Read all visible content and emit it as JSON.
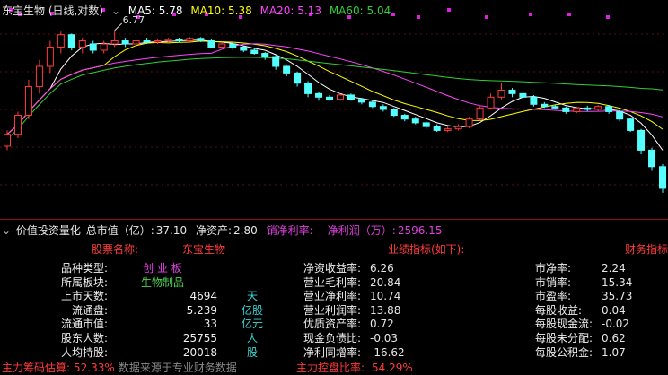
{
  "chart_header": {
    "title": "东宝生物 (日线,对数)",
    "ma": [
      {
        "label": "MA5: 5.78",
        "color": "#ffffff"
      },
      {
        "label": "MA10: 5.38",
        "color": "#ffff00"
      },
      {
        "label": "MA20: 5.13",
        "color": "#ff44ff"
      },
      {
        "label": "MA60: 5.04",
        "color": "#33cc33"
      }
    ],
    "high_marker": "6.77"
  },
  "panel": {
    "title": "价值投资量化",
    "mkt_cap_label": "总市值（亿）:",
    "mkt_cap_value": "37.10",
    "net_asset_label": "净资产:",
    "net_asset_value": "2.80",
    "net_margin_label": "销净利率:",
    "net_margin_value": "-",
    "net_profit_label": "净利润（万）:",
    "net_profit_value": "2596.15"
  },
  "sections": {
    "stock_name_header": "股票名称:",
    "stock_name": "东宝生物",
    "perf_header": "业绩指标(如下):",
    "fin_header": "财务指标"
  },
  "left_rows": [
    {
      "label": "品种类型:",
      "value": "创 业 板",
      "unit": ""
    },
    {
      "label": "所属板块:",
      "value": "生物制品",
      "unit": ""
    },
    {
      "label": "上市天数:",
      "value": "4694",
      "unit": "天"
    },
    {
      "label": "流通盘:",
      "value": "5.239",
      "unit": "亿股"
    },
    {
      "label": "流通市值:",
      "value": "33",
      "unit": "亿元"
    },
    {
      "label": "股东人数:",
      "value": "25755",
      "unit": "人"
    },
    {
      "label": "人均持股:",
      "value": "20018",
      "unit": "股"
    }
  ],
  "mid_rows": [
    {
      "label": "净资收益率:",
      "value": "6.26"
    },
    {
      "label": "营业毛利率:",
      "value": "20.84"
    },
    {
      "label": "营业净利率:",
      "value": "10.74"
    },
    {
      "label": "营业利润率:",
      "value": "13.88"
    },
    {
      "label": "优质资产率:",
      "value": "0.72"
    },
    {
      "label": "现金负债比:",
      "value": "-0.03"
    },
    {
      "label": "净利同增率:",
      "value": "-16.62"
    }
  ],
  "right_rows": [
    {
      "label": "市净率:",
      "value": "2.24"
    },
    {
      "label": "市销率:",
      "value": "15.34"
    },
    {
      "label": "市盈率:",
      "value": "35.73"
    },
    {
      "label": "每股收益:",
      "value": "0.04"
    },
    {
      "label": "每股现金流:",
      "value": "-0.02"
    },
    {
      "label": "每股未分配:",
      "value": "0.62"
    },
    {
      "label": "每股公积金:",
      "value": "1.07"
    }
  ],
  "footer": {
    "chip_label": "主力筹码估算:",
    "chip_value": "52.33%",
    "source_note": "数据来源于专业财务数据",
    "control_label": "主力控盘比率:",
    "control_value": "54.29%"
  },
  "chart_data": {
    "type": "candlestick",
    "candles": [
      [
        5.1,
        5.25,
        5.3,
        5.05
      ],
      [
        5.25,
        5.5,
        5.55,
        5.2
      ],
      [
        5.5,
        5.9,
        6.0,
        5.45
      ],
      [
        5.9,
        6.2,
        6.3,
        5.8
      ],
      [
        6.2,
        6.5,
        6.6,
        6.1
      ],
      [
        6.5,
        6.7,
        6.75,
        6.4
      ],
      [
        6.7,
        6.5,
        6.72,
        6.45
      ],
      [
        6.5,
        6.6,
        6.65,
        6.4
      ],
      [
        6.55,
        6.45,
        6.6,
        6.4
      ],
      [
        6.45,
        6.55,
        6.6,
        6.4
      ],
      [
        6.55,
        6.6,
        6.77,
        6.5
      ],
      [
        6.6,
        6.55,
        6.65,
        6.5
      ],
      [
        6.55,
        6.6,
        6.62,
        6.5
      ],
      [
        6.6,
        6.58,
        6.65,
        6.55
      ],
      [
        6.58,
        6.6,
        6.62,
        6.55
      ],
      [
        6.6,
        6.62,
        6.65,
        6.58
      ],
      [
        6.62,
        6.6,
        6.65,
        6.58
      ],
      [
        6.6,
        6.64,
        6.66,
        6.58
      ],
      [
        6.64,
        6.6,
        6.66,
        6.58
      ],
      [
        6.6,
        6.5,
        6.63,
        6.48
      ],
      [
        6.5,
        6.55,
        6.58,
        6.48
      ],
      [
        6.55,
        6.5,
        6.57,
        6.45
      ],
      [
        6.5,
        6.45,
        6.52,
        6.42
      ],
      [
        6.45,
        6.4,
        6.48,
        6.38
      ],
      [
        6.4,
        6.35,
        6.42,
        6.3
      ],
      [
        6.35,
        6.2,
        6.38,
        6.15
      ],
      [
        6.2,
        6.1,
        6.22,
        6.05
      ],
      [
        6.1,
        5.95,
        6.12,
        5.9
      ],
      [
        5.95,
        5.8,
        5.98,
        5.75
      ],
      [
        5.8,
        5.75,
        5.82,
        5.7
      ],
      [
        5.75,
        5.72,
        5.78,
        5.7
      ],
      [
        5.72,
        5.78,
        5.8,
        5.7
      ],
      [
        5.78,
        5.72,
        5.8,
        5.7
      ],
      [
        5.72,
        5.68,
        5.74,
        5.65
      ],
      [
        5.68,
        5.62,
        5.7,
        5.6
      ],
      [
        5.62,
        5.58,
        5.65,
        5.55
      ],
      [
        5.58,
        5.5,
        5.6,
        5.48
      ],
      [
        5.5,
        5.45,
        5.52,
        5.42
      ],
      [
        5.45,
        5.4,
        5.48,
        5.38
      ],
      [
        5.4,
        5.35,
        5.42,
        5.32
      ],
      [
        5.35,
        5.3,
        5.38,
        5.28
      ],
      [
        5.3,
        5.32,
        5.35,
        5.28
      ],
      [
        5.32,
        5.35,
        5.38,
        5.3
      ],
      [
        5.35,
        5.45,
        5.48,
        5.33
      ],
      [
        5.45,
        5.6,
        5.62,
        5.43
      ],
      [
        5.6,
        5.75,
        5.8,
        5.58
      ],
      [
        5.75,
        5.85,
        5.95,
        5.72
      ],
      [
        5.85,
        5.8,
        5.88,
        5.75
      ],
      [
        5.8,
        5.75,
        5.82,
        5.7
      ],
      [
        5.75,
        5.65,
        5.78,
        5.62
      ],
      [
        5.65,
        5.62,
        5.68,
        5.6
      ],
      [
        5.62,
        5.6,
        5.65,
        5.58
      ],
      [
        5.6,
        5.55,
        5.62,
        5.52
      ],
      [
        5.55,
        5.6,
        5.62,
        5.53
      ],
      [
        5.6,
        5.58,
        5.63,
        5.55
      ],
      [
        5.58,
        5.62,
        5.64,
        5.56
      ],
      [
        5.62,
        5.55,
        5.64,
        5.52
      ],
      [
        5.55,
        5.45,
        5.57,
        5.42
      ],
      [
        5.45,
        5.3,
        5.47,
        5.28
      ],
      [
        5.3,
        5.05,
        5.32,
        5.0
      ],
      [
        5.05,
        4.85,
        5.08,
        4.8
      ],
      [
        4.85,
        4.6,
        4.88,
        4.55
      ]
    ]
  }
}
